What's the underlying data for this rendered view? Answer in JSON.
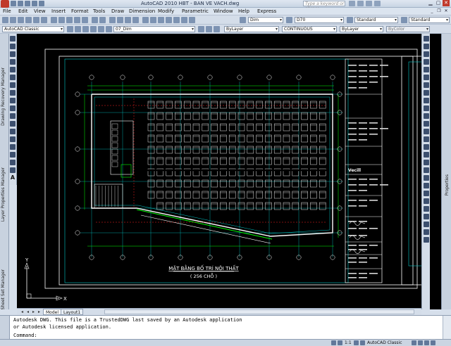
{
  "window": {
    "title": "AutoCAD 2010      HBT - BAN VE VACH.dwg",
    "search_placeholder": "Type a keyword or phrase"
  },
  "menu": [
    "File",
    "Edit",
    "View",
    "Insert",
    "Format",
    "Tools",
    "Draw",
    "Dimension",
    "Modify",
    "Parametric",
    "Window",
    "Help",
    "Express"
  ],
  "toolbar1": {
    "dim_style": "Dim",
    "dim_icon_value": "D70",
    "text_style": "Standard",
    "table_style": "Standard"
  },
  "toolbar2": {
    "workspace": "AutoCAD Classic",
    "layer": "07_Dim",
    "color": "ByLayer",
    "linetype": "CONTINUOUS",
    "lineweight": "ByLayer",
    "plotstyle": "ByColor"
  },
  "palettes": {
    "left": [
      "Drawing Recovery Manager",
      "Layer Properties Manager",
      "Sheet Set Manager"
    ],
    "right": "Properties"
  },
  "drawing": {
    "plan_title": "MẶT BẰNG BỐ TRÍ NỘI THẤT",
    "plan_subtitle": "( 256 CHỖ )",
    "ucs_x": "X",
    "ucs_y": "Y",
    "titleblock_logo": "Vecill"
  },
  "tabs": [
    "Model",
    "Layout1"
  ],
  "command": {
    "line1": "Autodesk DWG.  This file is a TrustedDWG last saved by an Autodesk application",
    "line2": "or Autodesk licensed application.",
    "prompt": "Command:"
  },
  "status": {
    "scale": "1:1",
    "workspace": "AutoCAD Classic"
  },
  "colors": {
    "canvas_bg": "#000000",
    "border_line": "#ffffff",
    "cyan_line": "#00c8c8",
    "green_line": "#00ff00",
    "red_line": "#ff2020",
    "chair_line": "#e8e8e8",
    "title_text": "#ffffff"
  }
}
